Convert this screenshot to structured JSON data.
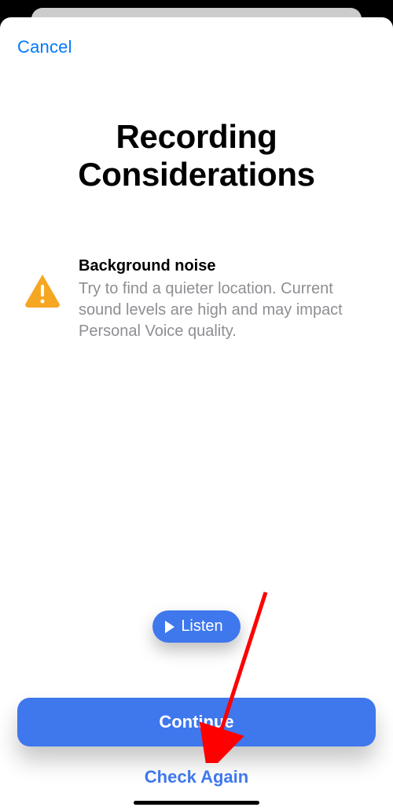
{
  "nav": {
    "cancel_label": "Cancel"
  },
  "page": {
    "title": "Recording Considerations"
  },
  "info": {
    "title": "Background noise",
    "body": "Try to find a quieter location. Current sound levels are high and may impact Personal Voice quality."
  },
  "buttons": {
    "listen_label": "Listen",
    "continue_label": "Continue",
    "check_again_label": "Check Again"
  },
  "colors": {
    "accent": "#3f77ed",
    "ios_blue": "#007aff",
    "warn": "#f5a623"
  }
}
